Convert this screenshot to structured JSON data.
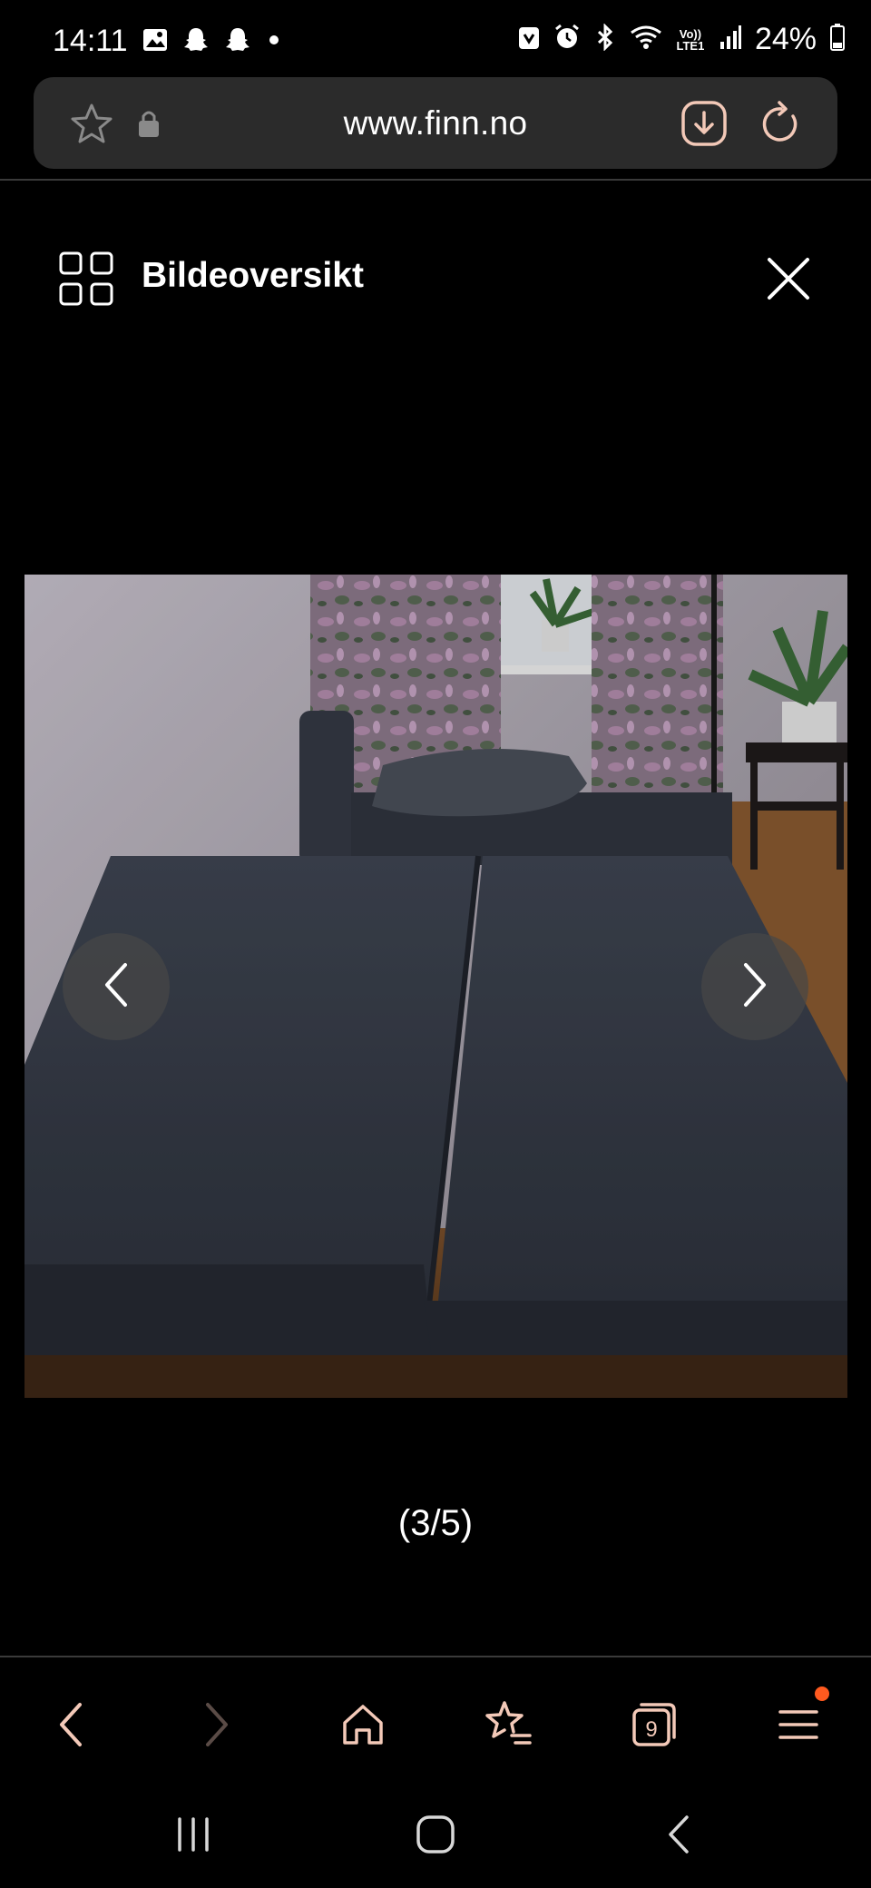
{
  "status_bar": {
    "time": "14:11",
    "left_icons": [
      "image-icon",
      "snapchat-icon",
      "snapchat-icon",
      "dot-icon"
    ],
    "right_icons": [
      "nfc-icon",
      "alarm-icon",
      "bluetooth-icon",
      "wifi-icon",
      "volte-icon",
      "signal-icon"
    ],
    "volte_label": "Vo)) LTE1",
    "battery": "24%"
  },
  "url_bar": {
    "url": "www.finn.no",
    "icons": [
      "star-icon",
      "lock-icon",
      "download-icon",
      "reload-icon"
    ]
  },
  "overview": {
    "title": "Bildeoversikt",
    "icon": "grid-icon",
    "close_icon": "close-icon"
  },
  "gallery": {
    "counter": "(3/5)",
    "image_alt": "sofa-bed-photo",
    "prev_icon": "chevron-left-icon",
    "next_icon": "chevron-right-icon"
  },
  "browser_nav": {
    "items": [
      "back-icon",
      "forward-icon",
      "home-icon",
      "bookmarks-icon",
      "tabs-icon",
      "menu-icon"
    ],
    "tabs_count": "9",
    "accent": "#f3c9b8",
    "badge_color": "#ff5a1f"
  },
  "system_nav": {
    "items": [
      "recents-icon",
      "home-button-icon",
      "back-button-icon"
    ]
  }
}
